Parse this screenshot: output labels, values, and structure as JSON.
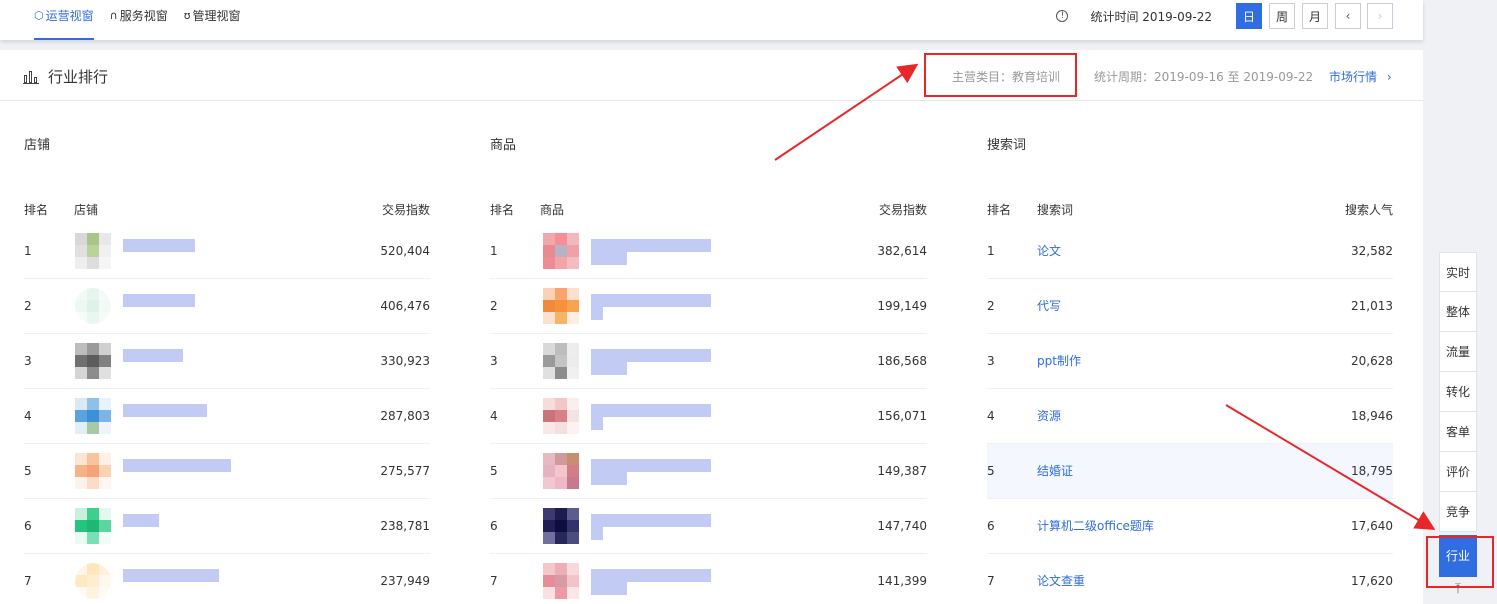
{
  "top": {
    "views": [
      {
        "icon": "shield-icon",
        "label": "运营视窗",
        "active": true
      },
      {
        "icon": "headset-icon",
        "label": "服务视窗",
        "active": false
      },
      {
        "icon": "medal-icon",
        "label": "管理视窗",
        "active": false
      }
    ],
    "info_icon": "!",
    "stat_time": "统计时间 2019-09-22",
    "periods": [
      "日",
      "周",
      "月"
    ],
    "prev": "‹",
    "next": "›"
  },
  "panel": {
    "title": "行业排行",
    "category": "主营类目：教育培训",
    "cycle": "统计周期：2019-09-16 至 2019-09-22",
    "market_link": "市场行情",
    "market_chevron": "›"
  },
  "shops": {
    "title": "店铺",
    "headers": {
      "rank": "排名",
      "name": "店铺",
      "value": "交易指数"
    },
    "rows": [
      {
        "rank": "1",
        "value": "520,404"
      },
      {
        "rank": "2",
        "value": "406,476"
      },
      {
        "rank": "3",
        "value": "330,923"
      },
      {
        "rank": "4",
        "value": "287,803"
      },
      {
        "rank": "5",
        "value": "275,577"
      },
      {
        "rank": "6",
        "value": "238,781"
      },
      {
        "rank": "7",
        "value": "237,949"
      }
    ]
  },
  "goods": {
    "title": "商品",
    "headers": {
      "rank": "排名",
      "name": "商品",
      "value": "交易指数"
    },
    "rows": [
      {
        "rank": "1",
        "value": "382,614"
      },
      {
        "rank": "2",
        "value": "199,149"
      },
      {
        "rank": "3",
        "value": "186,568"
      },
      {
        "rank": "4",
        "value": "156,071"
      },
      {
        "rank": "5",
        "value": "149,387"
      },
      {
        "rank": "6",
        "value": "147,740"
      },
      {
        "rank": "7",
        "value": "141,399"
      }
    ]
  },
  "keywords": {
    "title": "搜索词",
    "headers": {
      "rank": "排名",
      "name": "搜索词",
      "value": "搜索人气"
    },
    "rows": [
      {
        "rank": "1",
        "keyword": "论文",
        "value": "32,582"
      },
      {
        "rank": "2",
        "keyword": "代写",
        "value": "21,013"
      },
      {
        "rank": "3",
        "keyword": "ppt制作",
        "value": "20,628"
      },
      {
        "rank": "4",
        "keyword": "资源",
        "value": "18,946"
      },
      {
        "rank": "5",
        "keyword": "结婚证",
        "value": "18,795"
      },
      {
        "rank": "6",
        "keyword": "计算机二级office题库",
        "value": "17,640"
      },
      {
        "rank": "7",
        "keyword": "论文查重",
        "value": "17,620"
      }
    ]
  },
  "sidenav": {
    "items": [
      "实时",
      "整体",
      "流量",
      "转化",
      "客单",
      "评价",
      "竞争",
      "行业"
    ],
    "active": "行业",
    "up_icon": "⤒"
  },
  "colors": {
    "accent": "#2f6de1",
    "annotation": "#e9262a"
  }
}
